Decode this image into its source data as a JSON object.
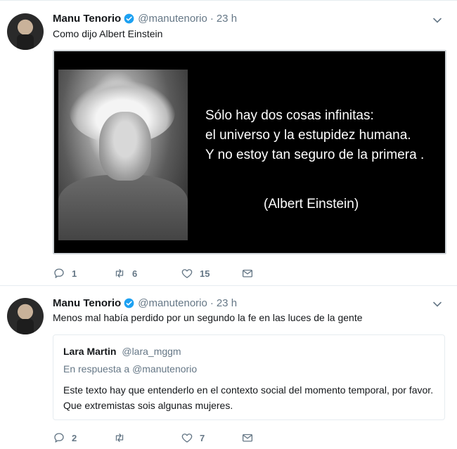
{
  "tweets": [
    {
      "author": "Manu Tenorio",
      "handle": "@manutenorio",
      "separator": "·",
      "time": "23 h",
      "text": "Como dijo Albert Einstein",
      "image": {
        "quote_lines": [
          "Sólo hay dos cosas infinitas:",
          "el universo y la  estupidez humana.",
          "Y no estoy tan seguro de la  primera ."
        ],
        "quote_author": "(Albert Einstein)"
      },
      "actions": {
        "replies": "1",
        "retweets": "6",
        "likes": "15"
      }
    },
    {
      "author": "Manu Tenorio",
      "handle": "@manutenorio",
      "separator": "·",
      "time": "23 h",
      "text": "Menos mal había perdido por un segundo la fe en las luces de la gente",
      "quoted": {
        "author": "Lara Martin",
        "handle": "@lara_mggm",
        "reply_prefix": "En respuesta a",
        "reply_to": "@manutenorio",
        "body": "Este texto hay que entenderlo en el contexto social del momento temporal, por favor. Que extremistas sois algunas mujeres."
      },
      "actions": {
        "replies": "2",
        "retweets": "",
        "likes": "7"
      }
    }
  ],
  "colors": {
    "verified": "#1da1f2",
    "muted": "#657786",
    "text": "#14171a",
    "border": "#e6ecf0"
  },
  "icons": [
    "verified-badge-icon",
    "caret-down-icon",
    "reply-icon",
    "retweet-icon",
    "like-icon",
    "direct-message-icon"
  ]
}
